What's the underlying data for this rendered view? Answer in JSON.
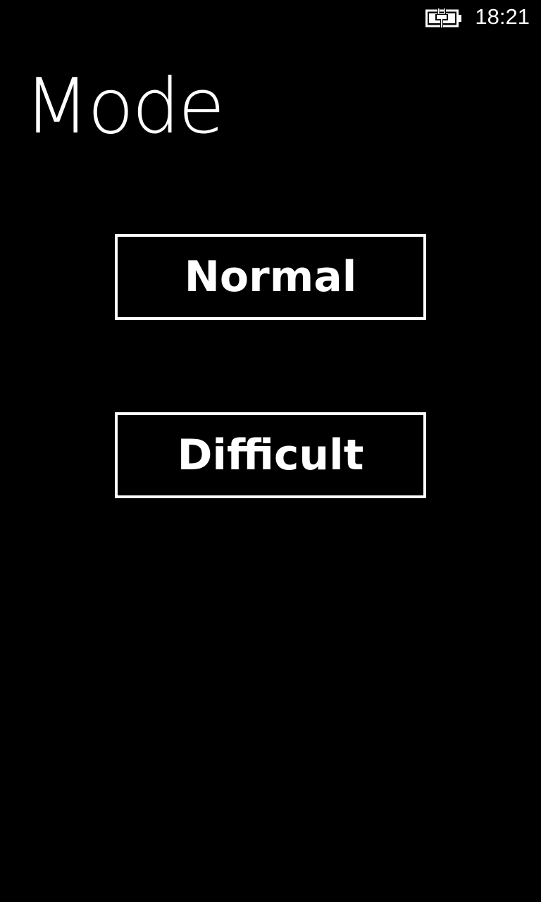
{
  "status_bar": {
    "battery_icon": "battery-charging-icon",
    "time": "18:21"
  },
  "page": {
    "title": "Mode"
  },
  "buttons": {
    "normal_label": "Normal",
    "difficult_label": "Difficult"
  },
  "colors": {
    "background": "#000000",
    "foreground": "#ffffff"
  }
}
